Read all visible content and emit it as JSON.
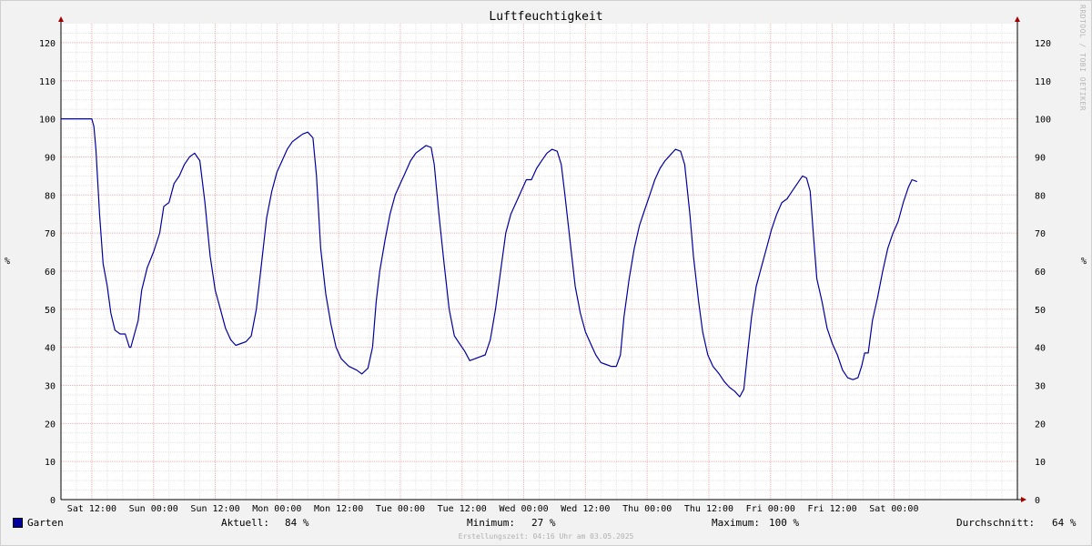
{
  "chart_data": {
    "type": "line",
    "title": "Luftfeuchtigkeit",
    "ylabel": "%",
    "ylim": [
      0,
      125
    ],
    "yticks": [
      0,
      10,
      20,
      30,
      40,
      50,
      60,
      70,
      80,
      90,
      100,
      110,
      120
    ],
    "x_hours": [
      0,
      186
    ],
    "xticks": [
      {
        "label": "Sat 12:00",
        "hour": 6
      },
      {
        "label": "Sun 00:00",
        "hour": 18
      },
      {
        "label": "Sun 12:00",
        "hour": 30
      },
      {
        "label": "Mon 00:00",
        "hour": 42
      },
      {
        "label": "Mon 12:00",
        "hour": 54
      },
      {
        "label": "Tue 00:00",
        "hour": 66
      },
      {
        "label": "Tue 12:00",
        "hour": 78
      },
      {
        "label": "Wed 00:00",
        "hour": 90
      },
      {
        "label": "Wed 12:00",
        "hour": 102
      },
      {
        "label": "Thu 00:00",
        "hour": 114
      },
      {
        "label": "Thu 12:00",
        "hour": 126
      },
      {
        "label": "Fri 00:00",
        "hour": 138
      },
      {
        "label": "Fri 12:00",
        "hour": 150
      },
      {
        "label": "Sat 00:00",
        "hour": 162
      }
    ],
    "grid": true,
    "series": [
      {
        "name": "Garten",
        "color": "#0000a0",
        "points": [
          [
            0,
            100
          ],
          [
            6,
            100
          ],
          [
            6.4,
            98
          ],
          [
            6.8,
            92
          ],
          [
            7.5,
            75
          ],
          [
            8.2,
            62
          ],
          [
            9,
            56
          ],
          [
            9.7,
            49
          ],
          [
            10.5,
            44.5
          ],
          [
            11.5,
            43.5
          ],
          [
            12.5,
            43.5
          ],
          [
            13.3,
            40
          ],
          [
            13.6,
            40
          ],
          [
            14.2,
            43
          ],
          [
            15,
            47
          ],
          [
            15.7,
            55
          ],
          [
            16.8,
            61
          ],
          [
            18,
            65
          ],
          [
            19.2,
            70
          ],
          [
            20,
            77
          ],
          [
            21,
            78
          ],
          [
            22,
            83
          ],
          [
            23,
            85
          ],
          [
            24,
            88
          ],
          [
            25,
            90
          ],
          [
            26,
            91
          ],
          [
            27,
            89
          ],
          [
            28,
            78
          ],
          [
            29,
            64
          ],
          [
            30,
            55
          ],
          [
            31,
            50
          ],
          [
            32,
            45
          ],
          [
            33,
            42
          ],
          [
            34,
            40.5
          ],
          [
            35,
            41
          ],
          [
            36,
            41.5
          ],
          [
            37,
            43
          ],
          [
            38,
            50
          ],
          [
            39,
            62
          ],
          [
            40,
            74
          ],
          [
            41,
            81
          ],
          [
            42,
            86
          ],
          [
            43,
            89
          ],
          [
            44,
            92
          ],
          [
            45,
            94
          ],
          [
            46,
            95
          ],
          [
            47,
            96
          ],
          [
            48,
            96.5
          ],
          [
            49,
            95
          ],
          [
            49.7,
            85
          ],
          [
            50.5,
            66
          ],
          [
            51.5,
            54
          ],
          [
            52.5,
            46
          ],
          [
            53.5,
            40
          ],
          [
            54.5,
            37
          ],
          [
            56,
            35
          ],
          [
            57.5,
            34
          ],
          [
            58.5,
            33
          ],
          [
            59.7,
            34.5
          ],
          [
            60.6,
            40
          ],
          [
            61.3,
            52
          ],
          [
            62,
            60
          ],
          [
            63,
            68
          ],
          [
            64,
            75
          ],
          [
            65,
            80
          ],
          [
            66,
            83
          ],
          [
            67,
            86
          ],
          [
            68,
            89
          ],
          [
            69,
            91
          ],
          [
            70,
            92
          ],
          [
            71,
            93
          ],
          [
            72,
            92.5
          ],
          [
            72.6,
            88
          ],
          [
            73.5,
            75
          ],
          [
            74.5,
            62
          ],
          [
            75.5,
            50
          ],
          [
            76.5,
            43
          ],
          [
            77.5,
            41
          ],
          [
            78.5,
            39
          ],
          [
            79.5,
            36.5
          ],
          [
            80.5,
            37
          ],
          [
            81.5,
            37.5
          ],
          [
            82.5,
            38
          ],
          [
            83.5,
            42
          ],
          [
            84.5,
            50
          ],
          [
            85.5,
            60
          ],
          [
            86.5,
            70
          ],
          [
            87.5,
            75
          ],
          [
            88.5,
            78
          ],
          [
            89.5,
            81
          ],
          [
            90.5,
            84
          ],
          [
            91.5,
            84
          ],
          [
            92.5,
            87
          ],
          [
            93.5,
            89
          ],
          [
            94.5,
            91
          ],
          [
            95.5,
            92
          ],
          [
            96.5,
            91.5
          ],
          [
            97.3,
            88
          ],
          [
            98,
            80
          ],
          [
            99,
            68
          ],
          [
            100,
            56
          ],
          [
            101,
            49
          ],
          [
            102,
            44
          ],
          [
            103,
            41
          ],
          [
            104,
            38
          ],
          [
            105,
            36
          ],
          [
            106,
            35.5
          ],
          [
            107,
            35
          ],
          [
            108,
            35
          ],
          [
            108.8,
            38
          ],
          [
            109.5,
            48
          ],
          [
            110.5,
            58
          ],
          [
            111.5,
            66
          ],
          [
            112.5,
            72
          ],
          [
            113.5,
            76
          ],
          [
            114.5,
            80
          ],
          [
            115.5,
            84
          ],
          [
            116.5,
            87
          ],
          [
            117.5,
            89
          ],
          [
            118.5,
            90.5
          ],
          [
            119.5,
            92
          ],
          [
            120.5,
            91.5
          ],
          [
            121.3,
            88
          ],
          [
            122.3,
            75
          ],
          [
            123,
            64
          ],
          [
            124,
            52
          ],
          [
            124.8,
            44
          ],
          [
            125.8,
            38
          ],
          [
            126.8,
            35
          ],
          [
            128,
            33
          ],
          [
            129,
            31
          ],
          [
            130,
            29.5
          ],
          [
            131,
            28.5
          ],
          [
            132,
            27
          ],
          [
            132.8,
            29
          ],
          [
            133.5,
            38
          ],
          [
            134.3,
            48
          ],
          [
            135.2,
            56
          ],
          [
            136.2,
            61
          ],
          [
            137.2,
            66
          ],
          [
            138.2,
            71
          ],
          [
            139.2,
            75
          ],
          [
            140.2,
            78
          ],
          [
            141.2,
            79
          ],
          [
            142.2,
            81
          ],
          [
            143.2,
            83
          ],
          [
            144.2,
            85
          ],
          [
            145,
            84.5
          ],
          [
            145.7,
            81
          ],
          [
            146.3,
            70
          ],
          [
            147,
            58
          ],
          [
            148,
            52
          ],
          [
            149,
            45
          ],
          [
            150,
            41
          ],
          [
            151,
            38
          ],
          [
            152,
            34
          ],
          [
            153,
            32
          ],
          [
            154,
            31.5
          ],
          [
            155,
            32
          ],
          [
            155.7,
            35
          ],
          [
            156.3,
            38.5
          ],
          [
            157,
            38.5
          ],
          [
            157.8,
            47
          ],
          [
            158.8,
            53
          ],
          [
            159.8,
            60
          ],
          [
            160.8,
            66
          ],
          [
            161.8,
            70
          ],
          [
            162.8,
            73
          ],
          [
            163.8,
            78
          ],
          [
            164.8,
            82
          ],
          [
            165.5,
            84
          ],
          [
            166.5,
            83.5
          ]
        ]
      }
    ]
  },
  "legend": {
    "series_name": "Garten",
    "aktuell_label": "Aktuell:",
    "aktuell_value": "84 %",
    "minimum_label": "Minimum:",
    "minimum_value": "27 %",
    "maximum_label": "Maximum:",
    "maximum_value": "100 %",
    "durchschnitt_label": "Durchschnitt:",
    "durchschnitt_value": "64 %"
  },
  "watermark": "RRDTOOL / TOBI OETIKER",
  "creation_stamp": "Erstellungszeit: 04:16 Uhr am 03.05.2025"
}
